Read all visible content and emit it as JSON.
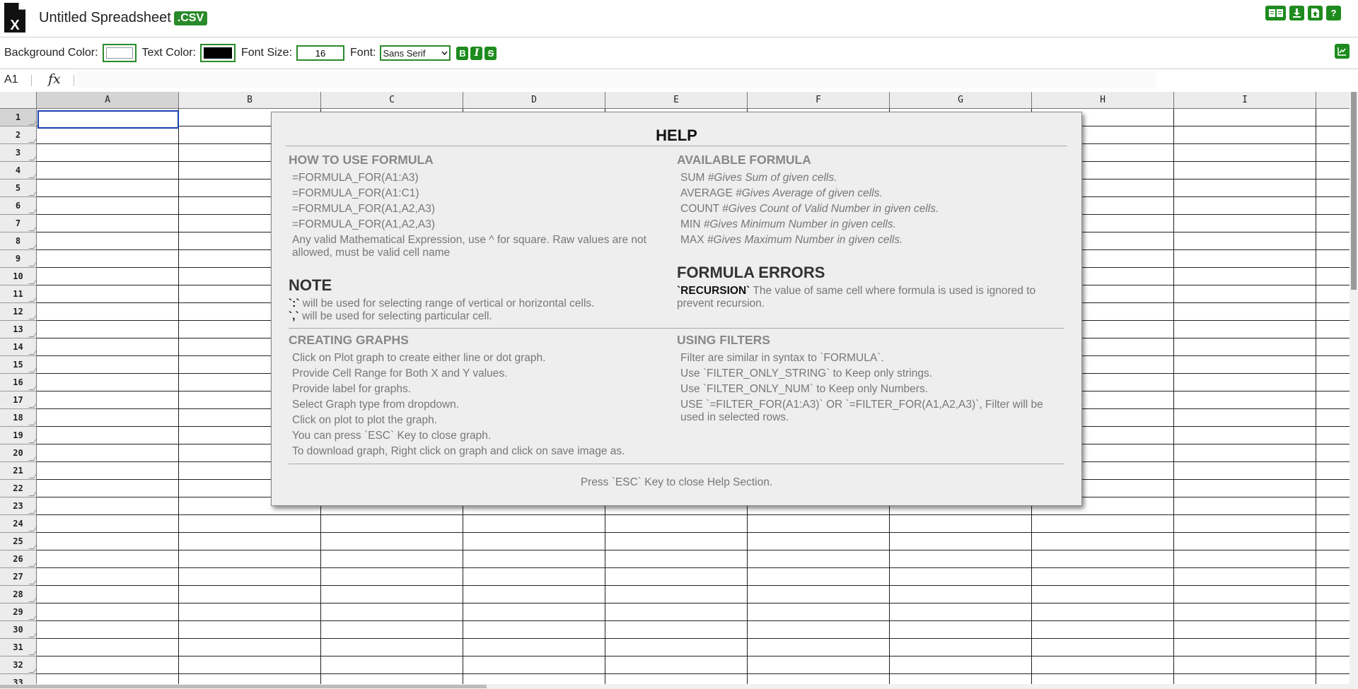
{
  "app": {
    "title": "Untitled Spreadsheet",
    "extension": ".CSV"
  },
  "toolbar": {
    "bg_color_label": "Background Color:",
    "text_color_label": "Text Color:",
    "font_size_label": "Font Size:",
    "font_size_value": "16",
    "font_label": "Font:",
    "font_value": "Sans Serif",
    "bg_color": "#ffffff",
    "text_color": "#000000",
    "accent_color": "#1e8b1e"
  },
  "formula_bar": {
    "cell_ref": "A1",
    "fx_label": "fx",
    "value": ""
  },
  "grid": {
    "columns": [
      "A",
      "B",
      "C",
      "D",
      "E",
      "F",
      "G",
      "H",
      "I"
    ],
    "rows": [
      "1",
      "2",
      "3",
      "4",
      "5",
      "6",
      "7",
      "8",
      "9",
      "10",
      "11",
      "12",
      "13",
      "14",
      "15",
      "16",
      "17",
      "18",
      "19",
      "20",
      "21",
      "22",
      "23",
      "24",
      "25",
      "26",
      "27",
      "28",
      "29",
      "30",
      "31",
      "32",
      "33"
    ],
    "selected_cell": "A1"
  },
  "help": {
    "title": "HELP",
    "how_to": {
      "heading": "HOW TO USE FORMULA",
      "lines": [
        "=FORMULA_FOR(A1:A3)",
        "=FORMULA_FOR(A1:C1)",
        "=FORMULA_FOR(A1,A2,A3)",
        "=FORMULA_FOR(A1,A2,A3)",
        "Any valid Mathematical Expression, use ^ for square. Raw values are not allowed, must be valid cell name"
      ]
    },
    "available": {
      "heading": "AVAILABLE FORMULA",
      "items": [
        {
          "name": "SUM",
          "desc": "#Gives Sum of given cells."
        },
        {
          "name": "AVERAGE",
          "desc": "#Gives Average of given cells."
        },
        {
          "name": "COUNT",
          "desc": "#Gives Count of Valid Number in given cells."
        },
        {
          "name": "MIN",
          "desc": "#Gives Minimum Number in given cells."
        },
        {
          "name": "MAX",
          "desc": "#Gives Maximum Number in given cells."
        }
      ]
    },
    "note": {
      "heading": "NOTE",
      "lines": [
        {
          "sym": "`:`",
          "text": " will be used for selecting range of vertical or horizontal cells."
        },
        {
          "sym": "`,`",
          "text": " will be used for selecting particular cell."
        }
      ]
    },
    "errors": {
      "heading": "FORMULA ERRORS",
      "name": "`RECURSION`",
      "text": " The value of same cell where formula is used is ignored to prevent recursion."
    },
    "graphs": {
      "heading": "CREATING GRAPHS",
      "lines": [
        "Click on Plot graph to create either line or dot graph.",
        "Provide Cell Range for Both X and Y values.",
        "Provide label for graphs.",
        "Select Graph type from dropdown.",
        "Click on plot to plot the graph.",
        "You can press `ESC` Key to close graph.",
        "To download graph, Right click on graph and click on save image as."
      ]
    },
    "filters": {
      "heading": "USING FILTERS",
      "lines": [
        "Filter are similar in syntax to `FORMULA`.",
        "Use `FILTER_ONLY_STRING` to Keep only strings.",
        "Use `FILTER_ONLY_NUM` to Keep only Numbers.",
        "USE `=FILTER_FOR(A1:A3)` OR `=FILTER_FOR(A1,A2,A3)`, Filter will be used in selected rows."
      ]
    },
    "close_hint": "Press `ESC` Key to close Help Section."
  }
}
